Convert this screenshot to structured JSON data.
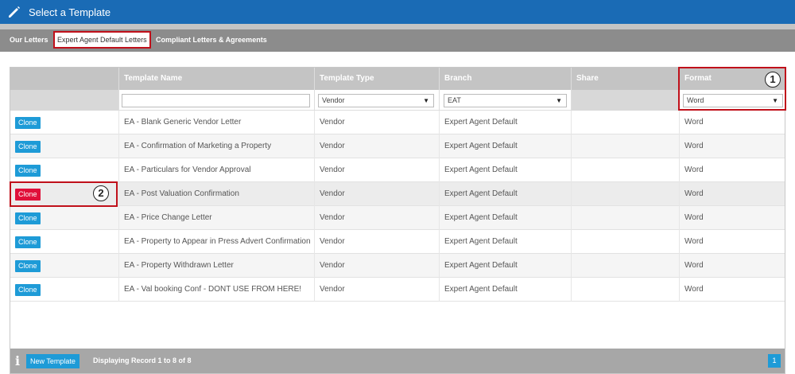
{
  "window": {
    "title": "Select a Template"
  },
  "tabs": [
    {
      "label": "Our Letters"
    },
    {
      "label": "Expert Agent Default Letters"
    },
    {
      "label": "Compliant Letters & Agreements"
    }
  ],
  "grid": {
    "columns": [
      "Template Name",
      "Template Type",
      "Branch",
      "Share",
      "Format"
    ],
    "filters": {
      "template_name": "",
      "template_type": "Vendor",
      "branch": "EAT",
      "format": "Word"
    },
    "clone_label": "Clone",
    "rows": [
      {
        "name": "EA - Blank Generic Vendor Letter",
        "type": "Vendor",
        "branch": "Expert Agent Default",
        "share": "",
        "format": "Word"
      },
      {
        "name": "EA - Confirmation of Marketing a Property",
        "type": "Vendor",
        "branch": "Expert Agent Default",
        "share": "",
        "format": "Word"
      },
      {
        "name": "EA - Particulars for Vendor Approval",
        "type": "Vendor",
        "branch": "Expert Agent Default",
        "share": "",
        "format": "Word"
      },
      {
        "name": "EA - Post Valuation Confirmation",
        "type": "Vendor",
        "branch": "Expert Agent Default",
        "share": "",
        "format": "Word"
      },
      {
        "name": "EA - Price Change Letter",
        "type": "Vendor",
        "branch": "Expert Agent Default",
        "share": "",
        "format": "Word"
      },
      {
        "name": "EA - Property to Appear in Press Advert Confirmation",
        "type": "Vendor",
        "branch": "Expert Agent Default",
        "share": "",
        "format": "Word"
      },
      {
        "name": "EA - Property Withdrawn Letter",
        "type": "Vendor",
        "branch": "Expert Agent Default",
        "share": "",
        "format": "Word"
      },
      {
        "name": "EA - Val booking Conf - DONT USE FROM HERE!",
        "type": "Vendor",
        "branch": "Expert Agent Default",
        "share": "",
        "format": "Word"
      }
    ]
  },
  "callouts": [
    "1",
    "2"
  ],
  "footer": {
    "info_icon": "i",
    "new_template_label": "New Template",
    "display_text": "Displaying Record 1 to 8 of 8",
    "page": "1"
  },
  "colors": {
    "titlebar": "#1a6bb5",
    "clone": "#1e9bd7",
    "clone_active": "#e0103a",
    "highlight": "#c0101a"
  }
}
